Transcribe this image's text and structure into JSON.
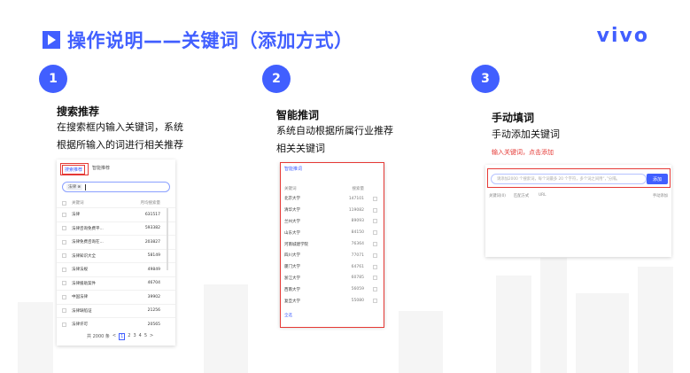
{
  "header": {
    "title": "操作说明——关键词（添加方式）",
    "logo": "vivo"
  },
  "steps": [
    {
      "number": "1",
      "title": "搜索推荐",
      "desc1": "在搜索框内输入关键词，系统",
      "desc2": "根据所输入的词进行相关推荐"
    },
    {
      "number": "2",
      "title": "智能推词",
      "desc1": "系统自动根据所属行业推荐",
      "desc2": "相关关键词"
    },
    {
      "number": "3",
      "title": "手动填词",
      "desc1": "手动添加关键词",
      "note": "输入关键词，点击添加"
    }
  ],
  "panel1": {
    "tab_search": "搜索推荐",
    "tab_smart": "智能推荐",
    "chip": "法律 ⊗",
    "head_word": "关键词",
    "head_num": "月均搜索量",
    "rows": [
      {
        "word": "法律",
        "num": "631517"
      },
      {
        "word": "法律咨询免费平...",
        "num": "593382"
      },
      {
        "word": "法律免费咨询在...",
        "num": "203827"
      },
      {
        "word": "法律知识大全",
        "num": "58149"
      },
      {
        "word": "法律法规",
        "num": "49849"
      },
      {
        "word": "法律援助案件",
        "num": "46704"
      },
      {
        "word": "中国法律",
        "num": "39902"
      },
      {
        "word": "法律缺陷证",
        "num": "21256"
      },
      {
        "word": "法律许可",
        "num": "20565"
      }
    ],
    "pager_total": "共 2000 条",
    "pager_pages": [
      "<",
      "1",
      "2",
      "3",
      "4",
      "5",
      ">"
    ]
  },
  "panel2": {
    "tab": "智能推词",
    "head_word": "关键词",
    "head_num": "搜索量",
    "rows": [
      {
        "word": "北京大学",
        "num": "147101"
      },
      {
        "word": "清华大学",
        "num": "119082"
      },
      {
        "word": "兰州大学",
        "num": "89093"
      },
      {
        "word": "山东大学",
        "num": "84150"
      },
      {
        "word": "河南城建学院",
        "num": "76364"
      },
      {
        "word": "四川大学",
        "num": "77071"
      },
      {
        "word": "厦门大学",
        "num": "64761"
      },
      {
        "word": "浙江大学",
        "num": "60785"
      },
      {
        "word": "西南大学",
        "num": "56059"
      },
      {
        "word": "复旦大学",
        "num": "55080"
      }
    ],
    "select_all": "全选"
  },
  "panel3": {
    "placeholder": "请添加2000 个搜索词，每个词最多 20 个字符，多个词之间用“，”分隔。",
    "add_button": "添加",
    "col1": "关键词(0)",
    "col2": "匹配方式",
    "col3": "URL",
    "col4": "手动添加"
  },
  "colors": {
    "accent": "#415fff",
    "red": "#e53935"
  }
}
